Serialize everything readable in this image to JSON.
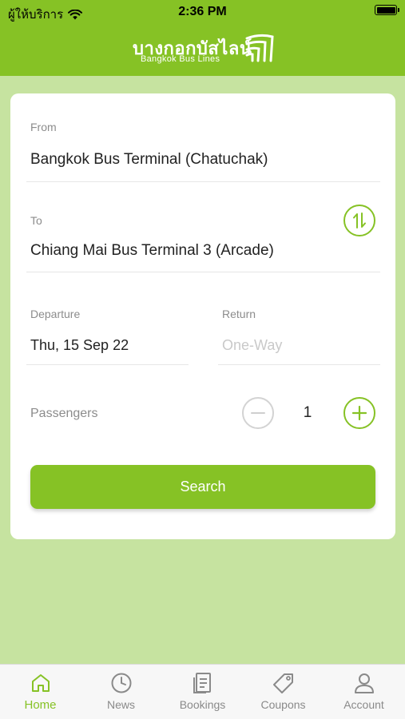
{
  "status_bar": {
    "carrier": "ผู้ให้บริการ",
    "time": "2:36 PM"
  },
  "header": {
    "logo_thai": "บางกอกบัสไลน์",
    "logo_english": "Bangkok Bus Lines"
  },
  "form": {
    "from": {
      "label": "From",
      "value": "Bangkok Bus Terminal (Chatuchak)"
    },
    "to": {
      "label": "To",
      "value": "Chiang Mai Bus Terminal 3 (Arcade)"
    },
    "departure": {
      "label": "Departure",
      "value": "Thu, 15 Sep 22"
    },
    "return": {
      "label": "Return",
      "placeholder": "One-Way"
    },
    "passengers": {
      "label": "Passengers",
      "count": "1"
    },
    "search_label": "Search"
  },
  "tabs": [
    {
      "label": "Home",
      "icon": "home-icon",
      "active": true
    },
    {
      "label": "News",
      "icon": "clock-icon",
      "active": false
    },
    {
      "label": "Bookings",
      "icon": "document-icon",
      "active": false
    },
    {
      "label": "Coupons",
      "icon": "tag-icon",
      "active": false
    },
    {
      "label": "Account",
      "icon": "person-icon",
      "active": false
    }
  ],
  "colors": {
    "accent": "#86c225",
    "background": "#c6e3a0",
    "card": "#ffffff",
    "tabbar": "#f7f7f7"
  }
}
